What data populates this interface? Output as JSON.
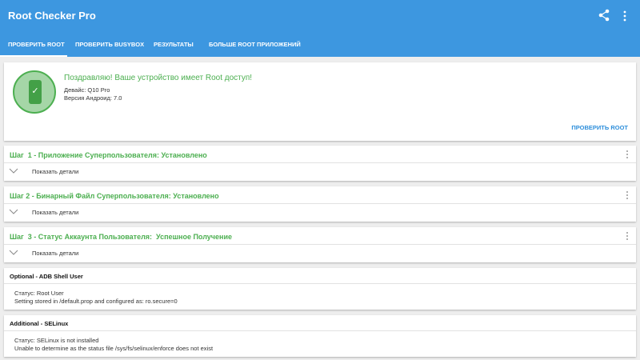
{
  "app": {
    "title": "Root Checker Pro"
  },
  "tabs": [
    {
      "label": "Проверить Root",
      "active": true
    },
    {
      "label": "Проверить BusyBox",
      "active": false
    },
    {
      "label": "Результаты",
      "active": false
    },
    {
      "label": "Больше Root приложений",
      "active": false
    }
  ],
  "status": {
    "message": "Поздравляю! Ваше устройство имеет Root доступ!",
    "device": "Девайс: Q10 Pro",
    "android_version": "Версия Андроид: 7.0",
    "check_button": "Проверить Root"
  },
  "steps": [
    {
      "title": "Шаг  1 - Приложение Суперпользователя: Установлено",
      "details_label": "Показать детали"
    },
    {
      "title": "Шаг 2 - Бинарный Файл Суперпользователя: Установлено",
      "details_label": "Показать детали"
    },
    {
      "title": "Шаг  3 - Статус Аккаунта Пользователя:  Успешное Получение",
      "details_label": "Показать детали"
    }
  ],
  "optional": {
    "title": "Optional - ADB Shell User",
    "line1": "Статус: Root User",
    "line2": "Setting stored in /default.prop and configured as: ro.secure=0"
  },
  "additional": {
    "title": "Additional - SELinux",
    "line1": "Статус: SELinux is not installed",
    "line2": "Unable to determine as the status file /sys/fs/selinux/enforce does not exist"
  },
  "colors": {
    "primary": "#3d97e0",
    "success": "#4caf50",
    "accent": "#2f8fdb"
  },
  "icons": [
    "share-icon",
    "more-vert-icon",
    "phone-check-icon",
    "chevron-down-icon"
  ]
}
